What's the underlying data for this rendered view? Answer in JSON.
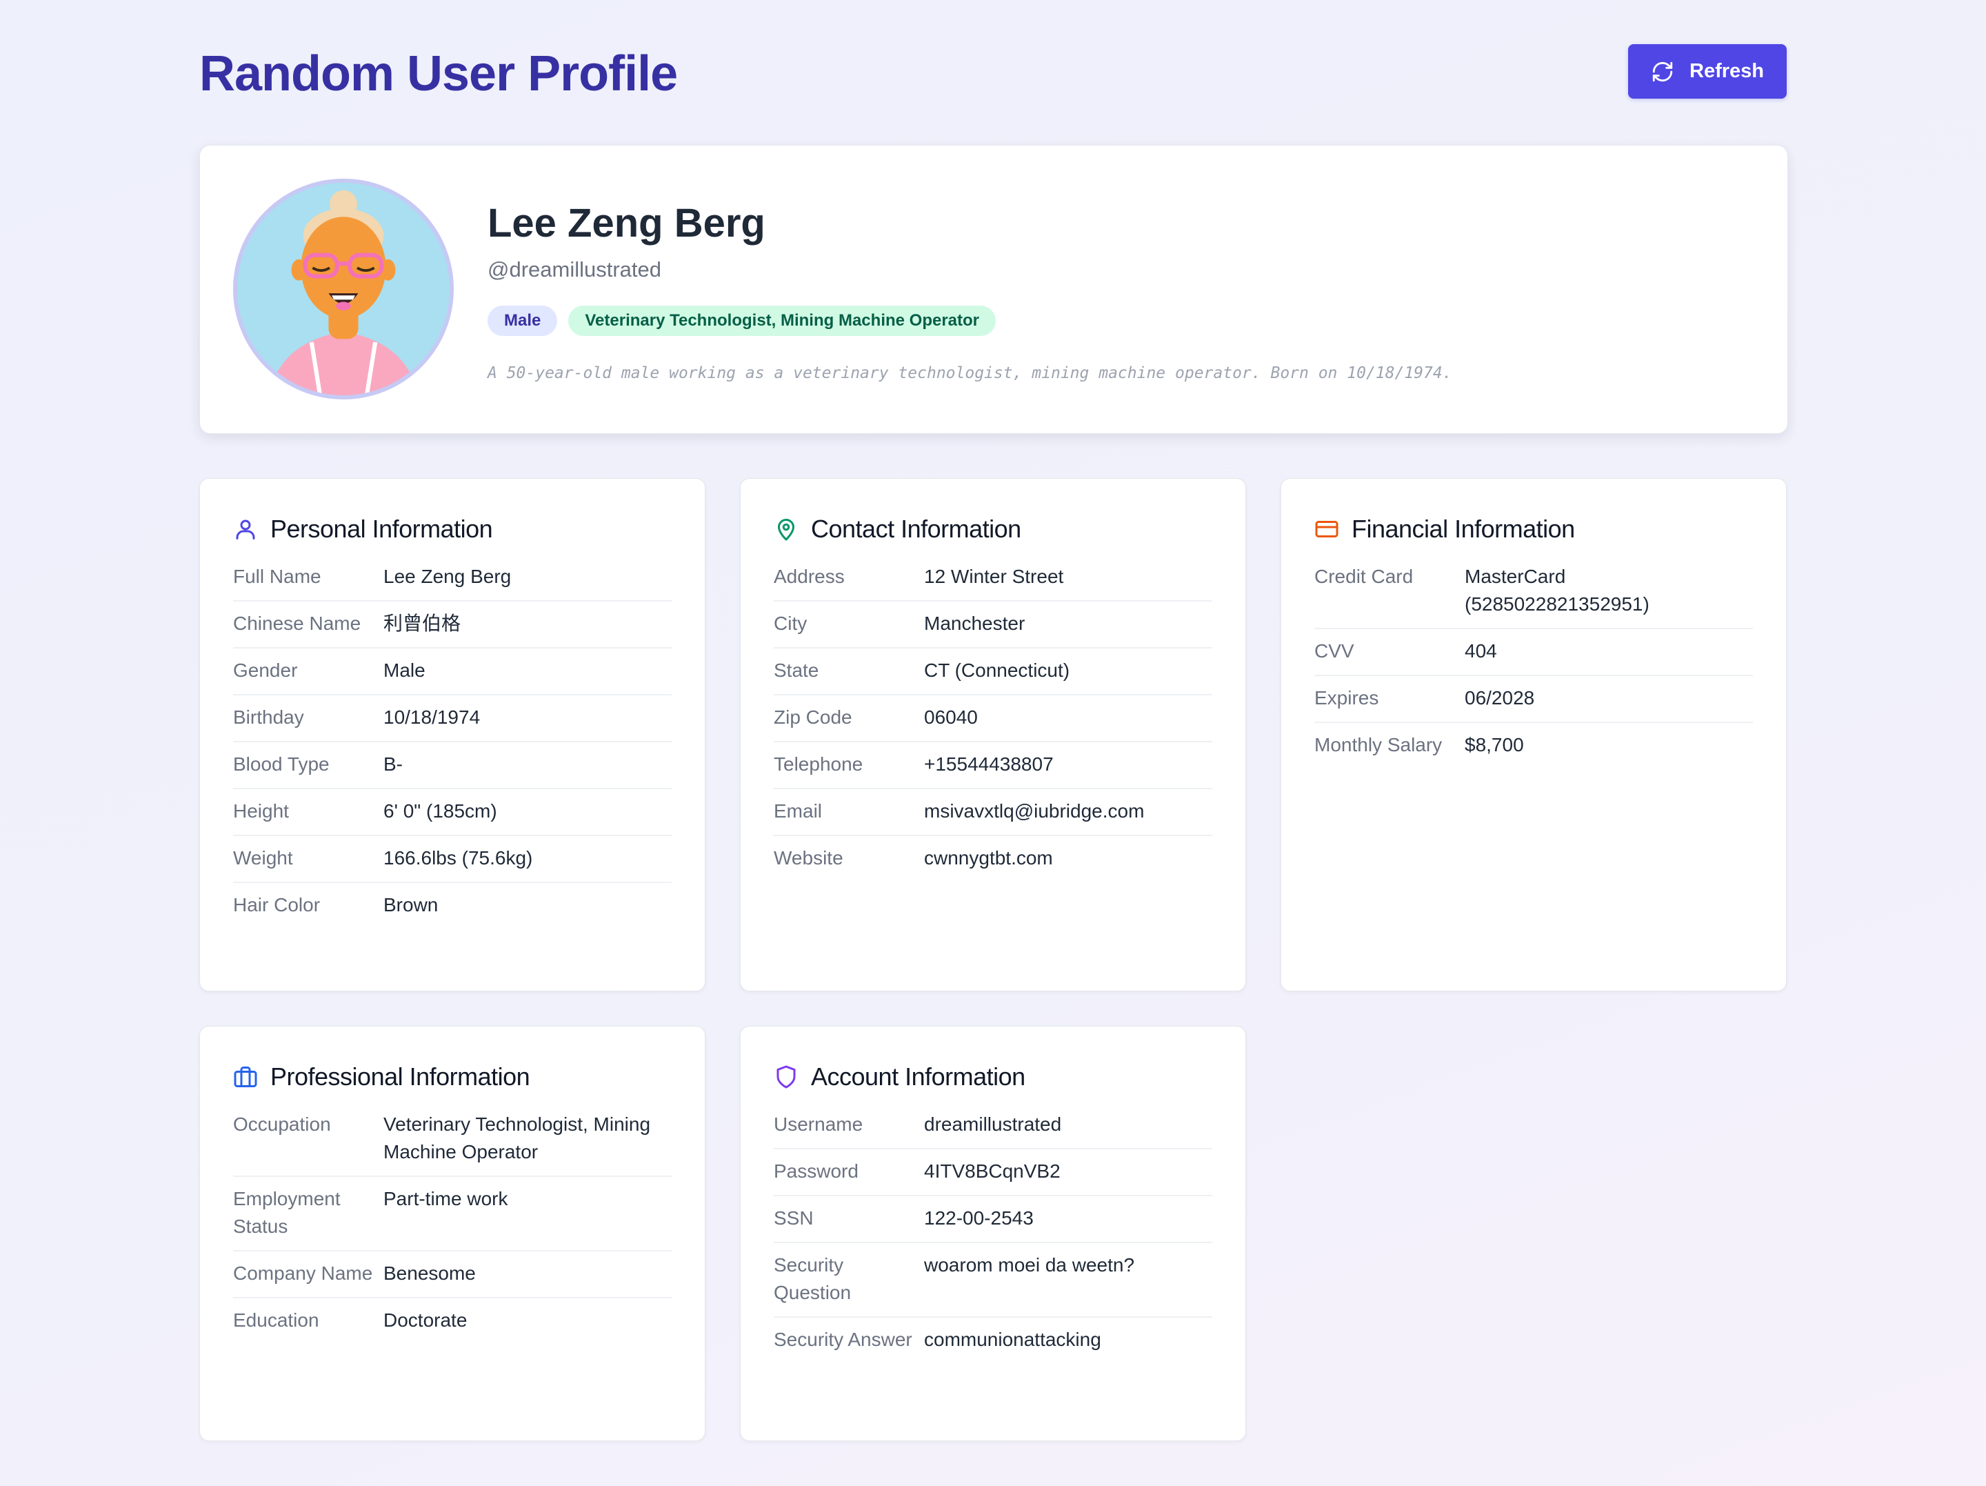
{
  "header": {
    "title": "Random User Profile",
    "refresh_label": "Refresh"
  },
  "profile": {
    "name": "Lee Zeng Berg",
    "handle": "@dreamillustrated",
    "gender_badge": "Male",
    "occupation_badge": "Veterinary Technologist, Mining Machine Operator",
    "summary": "A 50-year-old male working as a veterinary technologist, mining machine operator. Born on 10/18/1974."
  },
  "personal": {
    "title": "Personal Information",
    "rows": [
      {
        "label": "Full Name",
        "value": "Lee Zeng Berg"
      },
      {
        "label": "Chinese Name",
        "value": "利曾伯格"
      },
      {
        "label": "Gender",
        "value": "Male"
      },
      {
        "label": "Birthday",
        "value": "10/18/1974"
      },
      {
        "label": "Blood Type",
        "value": "B-"
      },
      {
        "label": "Height",
        "value": "6' 0\" (185cm)"
      },
      {
        "label": "Weight",
        "value": "166.6lbs (75.6kg)"
      },
      {
        "label": "Hair Color",
        "value": "Brown"
      }
    ]
  },
  "contact": {
    "title": "Contact Information",
    "rows": [
      {
        "label": "Address",
        "value": "12 Winter Street"
      },
      {
        "label": "City",
        "value": "Manchester"
      },
      {
        "label": "State",
        "value": "CT (Connecticut)"
      },
      {
        "label": "Zip Code",
        "value": "06040"
      },
      {
        "label": "Telephone",
        "value": "+15544438807"
      },
      {
        "label": "Email",
        "value": "msivavxtlq@iubridge.com"
      },
      {
        "label": "Website",
        "value": "cwnnygtbt.com"
      }
    ]
  },
  "financial": {
    "title": "Financial Information",
    "rows": [
      {
        "label": "Credit Card",
        "value": "MasterCard (5285022821352951)"
      },
      {
        "label": "CVV",
        "value": "404"
      },
      {
        "label": "Expires",
        "value": "06/2028"
      },
      {
        "label": "Monthly Salary",
        "value": "$8,700"
      }
    ]
  },
  "professional": {
    "title": "Professional Information",
    "rows": [
      {
        "label": "Occupation",
        "value": "Veterinary Technologist, Mining Machine Operator"
      },
      {
        "label": "Employment Status",
        "value": "Part-time work"
      },
      {
        "label": "Company Name",
        "value": "Benesome"
      },
      {
        "label": "Education",
        "value": "Doctorate"
      }
    ]
  },
  "account": {
    "title": "Account Information",
    "rows": [
      {
        "label": "Username",
        "value": "dreamillustrated"
      },
      {
        "label": "Password",
        "value": "4ITV8BCqnVB2"
      },
      {
        "label": "SSN",
        "value": "122-00-2543"
      },
      {
        "label": "Security Question",
        "value": "woarom moei da weetn?"
      },
      {
        "label": "Security Answer",
        "value": "communionattacking"
      }
    ]
  },
  "colors": {
    "accent": "#4f46e5",
    "title": "#3730a3",
    "personal_icon": "#4f46e5",
    "contact_icon": "#059669",
    "financial_icon": "#ea580c",
    "professional_icon": "#2563eb",
    "account_icon": "#7c3aed"
  },
  "icons": {
    "refresh": "refresh-icon",
    "personal": "user-icon",
    "contact": "map-pin-icon",
    "financial": "credit-card-icon",
    "professional": "briefcase-icon",
    "account": "shield-icon"
  }
}
